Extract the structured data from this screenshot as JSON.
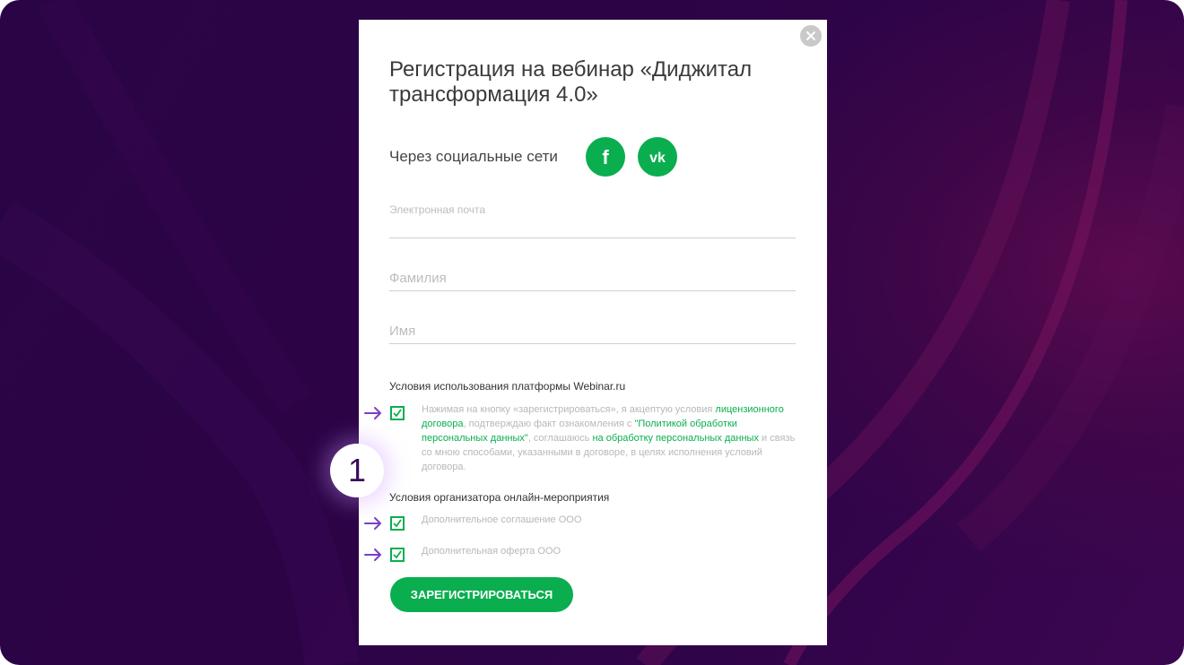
{
  "modal": {
    "title": "Регистрация на вебинар «Диджитал трансформация 4.0»",
    "social_label": "Через социальные сети",
    "social_buttons": [
      {
        "icon": "facebook-icon",
        "glyph": "f"
      },
      {
        "icon": "vk-icon",
        "glyph": "vk"
      }
    ],
    "fields": {
      "email_label": "Электронная почта",
      "surname_placeholder": "Фамилия",
      "name_placeholder": "Имя"
    },
    "platform_terms": {
      "heading": "Условия использования платформы Webinar.ru",
      "checked": true,
      "t1": "Нажимая на кнопку «зарегистрироваться», я акцептую условия ",
      "link1": "лицензионного договора",
      "t2": ", подтверждаю факт ознакомления с ",
      "link2": "\"Политикой обработки персональных данных\"",
      "t3": ", соглашаюсь ",
      "link3": "на обработку персональных данных",
      "t4": " и связь со мною способами, указанными в договоре, в целях исполнения условий договора."
    },
    "organizer_terms": {
      "heading": "Условия организатора онлайн-мероприятия",
      "items": [
        {
          "label": "Дополнительное соглашение ООО",
          "checked": true
        },
        {
          "label": "Дополнительная оферта ООО",
          "checked": true
        }
      ]
    },
    "submit_label": "ЗАРЕГИСТРИРОВАТЬСЯ"
  },
  "annotation": {
    "badge_number": "1"
  },
  "colors": {
    "accent": "#0aae4f",
    "background": "#2c0446",
    "annotation_arrow": "#7b3fc4"
  }
}
